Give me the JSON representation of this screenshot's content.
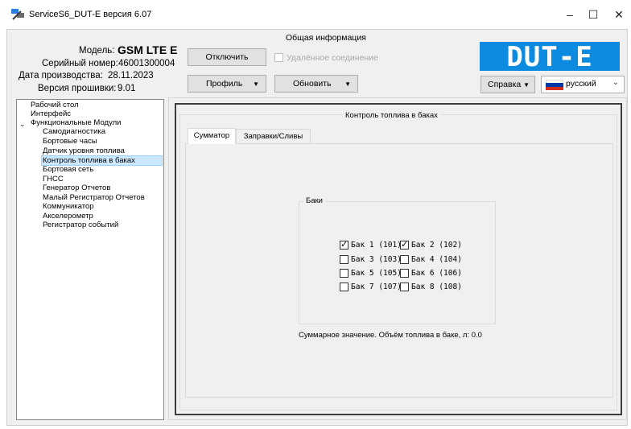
{
  "window": {
    "title": "ServiceS6_DUT-E версия 6.07",
    "minimize": "–",
    "maximize": "☐",
    "close": "✕"
  },
  "info": {
    "section_title": "Общая информация",
    "model_label": "Модель:",
    "model_value": "GSM LTE E",
    "serial_label": "Серийный номер:",
    "serial_value": "46001300004",
    "date_label": "Дата производства:",
    "date_value": "28.11.2023",
    "firmware_label": "Версия прошивки:",
    "firmware_value": "9.01"
  },
  "toolbar": {
    "disconnect_label": "Отключить",
    "remote_label": "Удалённое соединение",
    "remote_checked": false,
    "profile_label": "Профиль",
    "update_label": "Обновить",
    "help_label": "Справка",
    "language_value": "русский",
    "logo_text": "DUT-E"
  },
  "colors": {
    "logo_bg": "#0d8be0",
    "selection_bg": "#cce8ff",
    "flag_white": "#ffffff",
    "flag_blue": "#0039a6",
    "flag_red": "#d52b1e"
  },
  "tree": {
    "items": [
      {
        "label": "Рабочий стол",
        "level": 0
      },
      {
        "label": "Интерфейс",
        "level": 0
      },
      {
        "label": "Функциональные Модули",
        "level": 0,
        "expanded": true
      },
      {
        "label": "Самодиагностика",
        "level": 1
      },
      {
        "label": "Бортовые часы",
        "level": 1
      },
      {
        "label": "Датчик уровня топлива",
        "level": 1
      },
      {
        "label": "Контроль топлива в баках",
        "level": 1,
        "selected": true
      },
      {
        "label": "Бортовая сеть",
        "level": 1
      },
      {
        "label": "ГНСС",
        "level": 1
      },
      {
        "label": "Генератор Отчетов",
        "level": 1
      },
      {
        "label": "Малый Регистратор Отчетов",
        "level": 1
      },
      {
        "label": "Коммуникатор",
        "level": 1
      },
      {
        "label": "Акселерометр",
        "level": 1
      },
      {
        "label": "Регистратор событий",
        "level": 1
      }
    ]
  },
  "content": {
    "group_title": "Контроль топлива в баках",
    "tabs": [
      {
        "label": "Сумматор",
        "active": true
      },
      {
        "label": "Заправки/Сливы",
        "active": false
      }
    ],
    "tanks_title": "Баки",
    "tanks": [
      {
        "label": "Бак 1 (101)",
        "checked": true
      },
      {
        "label": "Бак 2 (102)",
        "checked": true
      },
      {
        "label": "Бак 3 (103)",
        "checked": false
      },
      {
        "label": "Бак 4 (104)",
        "checked": false
      },
      {
        "label": "Бак 5 (105)",
        "checked": false
      },
      {
        "label": "Бак 6 (106)",
        "checked": false
      },
      {
        "label": "Бак 7 (107)",
        "checked": false
      },
      {
        "label": "Бак 8 (108)",
        "checked": false
      }
    ],
    "summary": "Суммарное значение. Объём топлива в баке, л: 0.0"
  }
}
